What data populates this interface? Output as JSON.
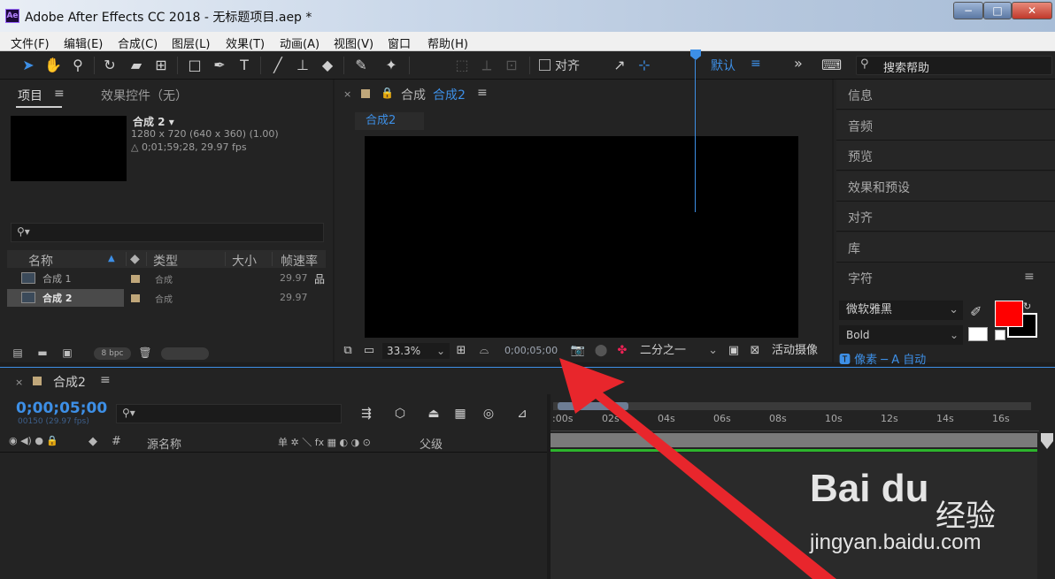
{
  "window": {
    "logo": "Ae",
    "title": "Adobe After Effects CC 2018 - 无标题项目.aep *",
    "min": "−",
    "max": "□",
    "close": "✕"
  },
  "menu": [
    "文件(F)",
    "编辑(E)",
    "合成(C)",
    "图层(L)",
    "效果(T)",
    "动画(A)",
    "视图(V)",
    "窗口",
    "帮助(H)"
  ],
  "toolbar": {
    "align_label": "对齐",
    "workspace": "默认",
    "workspace_menu": "≡",
    "more": "»",
    "search_placeholder": "搜索帮助",
    "search_icon": "⚲"
  },
  "project": {
    "tab_project": "项目",
    "tab_menu": "≡",
    "tab_effects": "效果控件（无）",
    "comp_name": "合成 2 ▾",
    "comp_res": "1280 x 720  (640 x 360) (1.00)",
    "comp_dur": "△ 0;01;59;28, 29.97 fps",
    "search_icon": "⚲▾",
    "columns": {
      "name": "名称",
      "sort": "▲",
      "type": "类型",
      "size": "大小",
      "fps": "帧速率"
    },
    "rows": [
      {
        "name": "合成 1",
        "type": "合成",
        "fps": "29.97",
        "extra": "品"
      },
      {
        "name": "合成 2",
        "type": "合成",
        "fps": "29.97",
        "extra": ""
      }
    ],
    "bpc": "8 bpc"
  },
  "comp": {
    "close": "×",
    "lock": "🔒",
    "tab_prefix": "合成",
    "tab_name": "合成2",
    "tab_menu": "≡",
    "chip": "合成2",
    "zoom": "33.3%",
    "timecode": "0;00;05;00",
    "resolution": "二分之一",
    "camera": "活动摄像"
  },
  "right": {
    "items": [
      "信息",
      "音频",
      "预览",
      "效果和预设",
      "对齐",
      "库",
      "字符"
    ],
    "char_menu": "≡",
    "font_family": "微软雅黑",
    "font_style": "Bold",
    "char_cut": "🆃 像素  ─   A 自动"
  },
  "timeline": {
    "close": "×",
    "tab_name": "合成2",
    "tab_menu": "≡",
    "timecode": "0;00;05;00",
    "frames": "00150 (29.97 fps)",
    "search_icon": "⚲▾",
    "col_icons": "◉ ◀) ● 🔒",
    "col_label": "◆",
    "col_num": "#",
    "col_source": "源名称",
    "col_switches": "单 ✲ ＼ fx ▦ ◐ ◑ ⊙",
    "col_parent": "父级",
    "ticks": [
      ":00s",
      "02s",
      "04s",
      "06s",
      "08s",
      "10s",
      "12s",
      "14s",
      "16s"
    ]
  },
  "watermark": {
    "logo": "Bai du",
    "cn": "经验",
    "url": "jingyan.baidu.com"
  },
  "colors": {
    "accent": "#3d8fe6",
    "arrow": "#e8262c",
    "fill_swatch": "#ff0000",
    "label_swatch": "#c0a77a"
  }
}
